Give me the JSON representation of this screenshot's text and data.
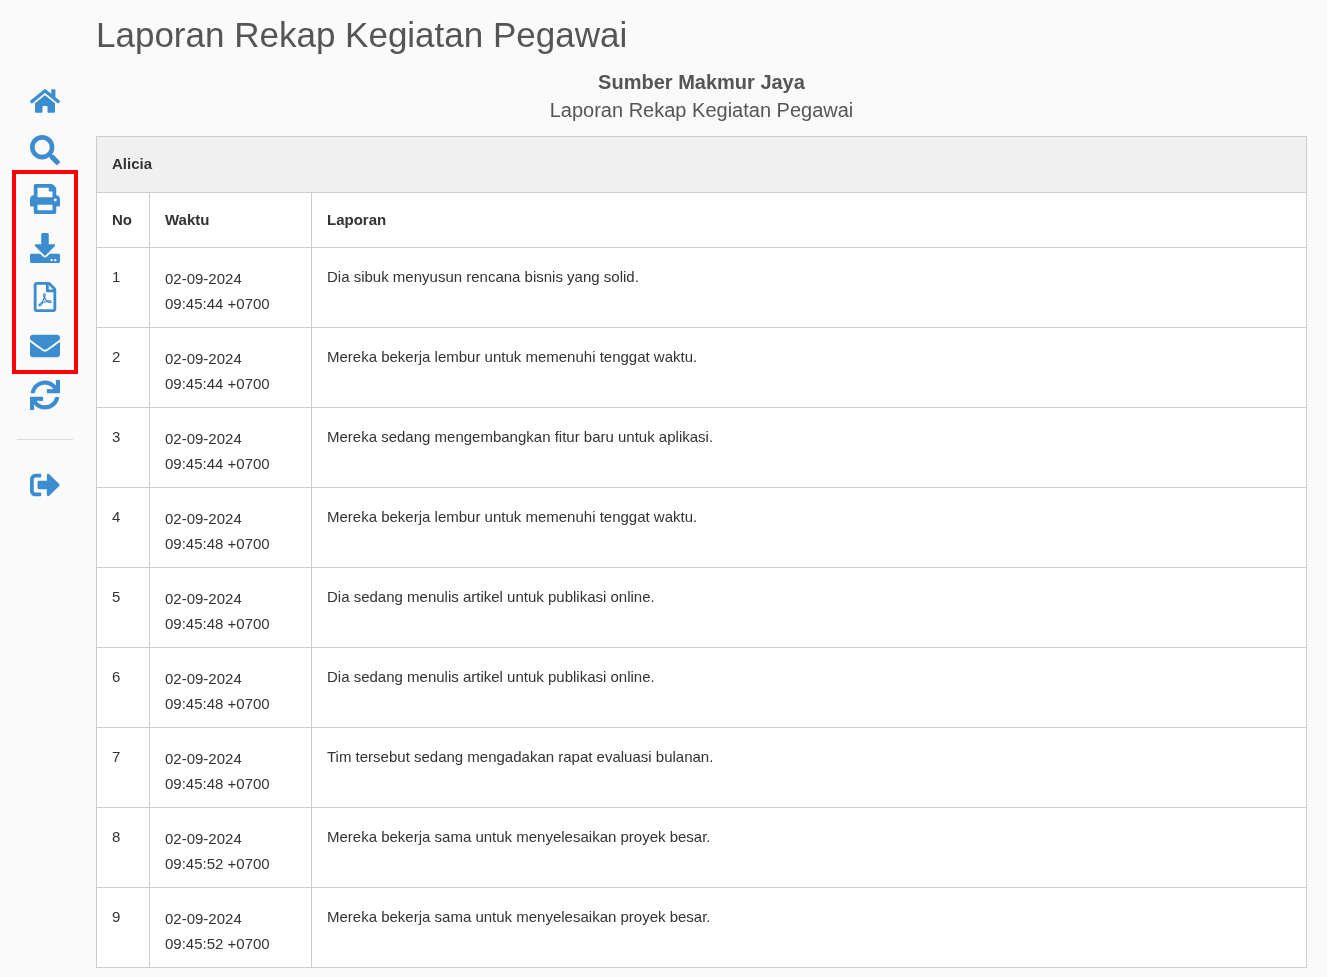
{
  "page_title": "Laporan Rekap Kegiatan Pegawai",
  "sidebar": {
    "items": [
      {
        "kind": "home",
        "highlighted": false
      },
      {
        "kind": "search",
        "highlighted": false
      },
      {
        "kind": "print",
        "highlighted": true
      },
      {
        "kind": "download",
        "highlighted": true
      },
      {
        "kind": "pdf",
        "highlighted": true
      },
      {
        "kind": "mail",
        "highlighted": true
      },
      {
        "kind": "refresh",
        "highlighted": false
      },
      {
        "kind": "divider",
        "highlighted": false
      },
      {
        "kind": "logout",
        "highlighted": false
      }
    ]
  },
  "report": {
    "company": "Sumber Makmur Jaya",
    "subtitle": "Laporan Rekap Kegiatan Pegawai"
  },
  "table": {
    "group": "Alicia",
    "columns": [
      "No",
      "Waktu",
      "Laporan"
    ],
    "rows": [
      {
        "no": "1",
        "date": "02-09-2024",
        "time": "09:45:44 +0700",
        "report": "Dia sibuk menyusun rencana bisnis yang solid."
      },
      {
        "no": "2",
        "date": "02-09-2024",
        "time": "09:45:44 +0700",
        "report": "Mereka bekerja lembur untuk memenuhi tenggat waktu."
      },
      {
        "no": "3",
        "date": "02-09-2024",
        "time": "09:45:44 +0700",
        "report": "Mereka sedang mengembangkan fitur baru untuk aplikasi."
      },
      {
        "no": "4",
        "date": "02-09-2024",
        "time": "09:45:48 +0700",
        "report": "Mereka bekerja lembur untuk memenuhi tenggat waktu."
      },
      {
        "no": "5",
        "date": "02-09-2024",
        "time": "09:45:48 +0700",
        "report": "Dia sedang menulis artikel untuk publikasi online."
      },
      {
        "no": "6",
        "date": "02-09-2024",
        "time": "09:45:48 +0700",
        "report": "Dia sedang menulis artikel untuk publikasi online."
      },
      {
        "no": "7",
        "date": "02-09-2024",
        "time": "09:45:48 +0700",
        "report": "Tim tersebut sedang mengadakan rapat evaluasi bulanan."
      },
      {
        "no": "8",
        "date": "02-09-2024",
        "time": "09:45:52 +0700",
        "report": "Mereka bekerja sama untuk menyelesaikan proyek besar."
      },
      {
        "no": "9",
        "date": "02-09-2024",
        "time": "09:45:52 +0700",
        "report": "Mereka bekerja sama untuk menyelesaikan proyek besar."
      }
    ]
  }
}
